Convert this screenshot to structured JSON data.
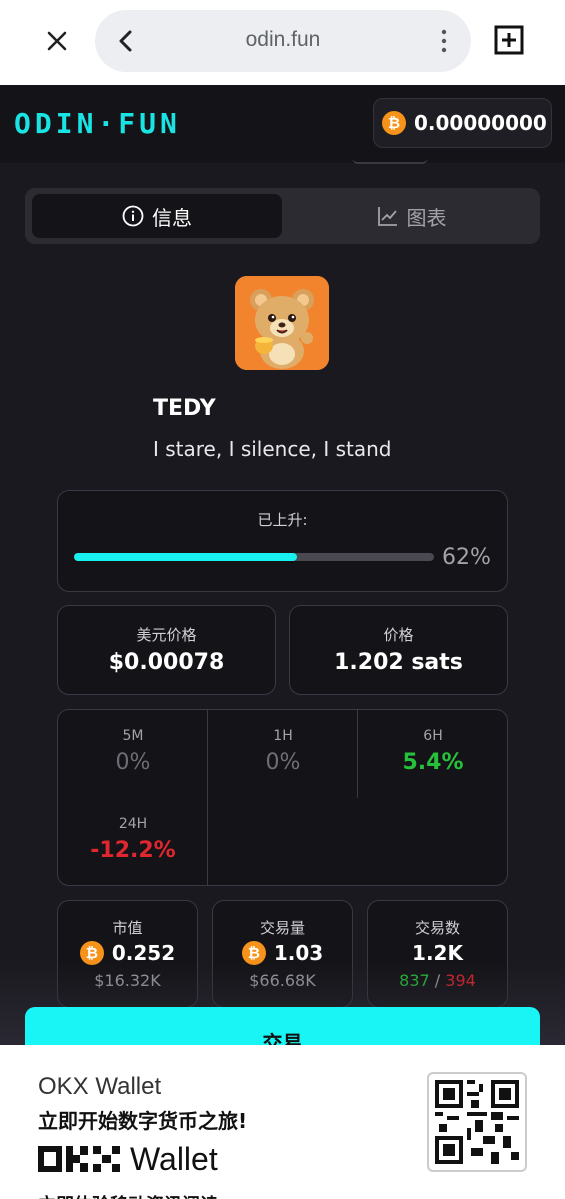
{
  "browser": {
    "url": "odin.fun",
    "icons": [
      "close-icon",
      "back-icon",
      "more-vert-icon",
      "new-tab-icon"
    ]
  },
  "header": {
    "logo": "ODIN·FUN",
    "balance": "0.00000000",
    "btc_symbol": "₿"
  },
  "tabs": [
    {
      "label": "信息",
      "icon": "info-icon",
      "active": true
    },
    {
      "label": "图表",
      "icon": "chart-icon",
      "active": false
    }
  ],
  "token": {
    "name": "TEDY",
    "description": "I stare, I silence, I stand"
  },
  "progress": {
    "label": "已上升:",
    "percent_text": "62%",
    "fraction": 0.62
  },
  "prices": {
    "usd": {
      "label": "美元价格",
      "value": "$0.00078"
    },
    "sats": {
      "label": "价格",
      "value": "1.202 sats"
    }
  },
  "changes": [
    {
      "period": "5M",
      "value": "0%",
      "trend": "neutral"
    },
    {
      "period": "1H",
      "value": "0%",
      "trend": "neutral"
    },
    {
      "period": "6H",
      "value": "5.4%",
      "trend": "pos"
    },
    {
      "period": "24H",
      "value": "-12.2%",
      "trend": "neg"
    }
  ],
  "stats": {
    "market_cap": {
      "label": "市值",
      "btc": "0.252",
      "usd": "$16.32K"
    },
    "volume": {
      "label": "交易量",
      "btc": "1.03",
      "usd": "$66.68K"
    },
    "trades": {
      "label": "交易数",
      "count": "1.2K",
      "buys": "837",
      "separator": "/",
      "sells": "394"
    }
  },
  "trade_button": "交易",
  "ad": {
    "title": "OKX Wallet",
    "subtitle": "立即开始数字货币之旅!",
    "logo_text": "Wallet",
    "cut_text": "立即体验移动资讯阅读"
  },
  "colors": {
    "accent": "#19e3e3",
    "btc": "#f7931a",
    "positive": "#26c13a",
    "negative": "#e0262e"
  }
}
